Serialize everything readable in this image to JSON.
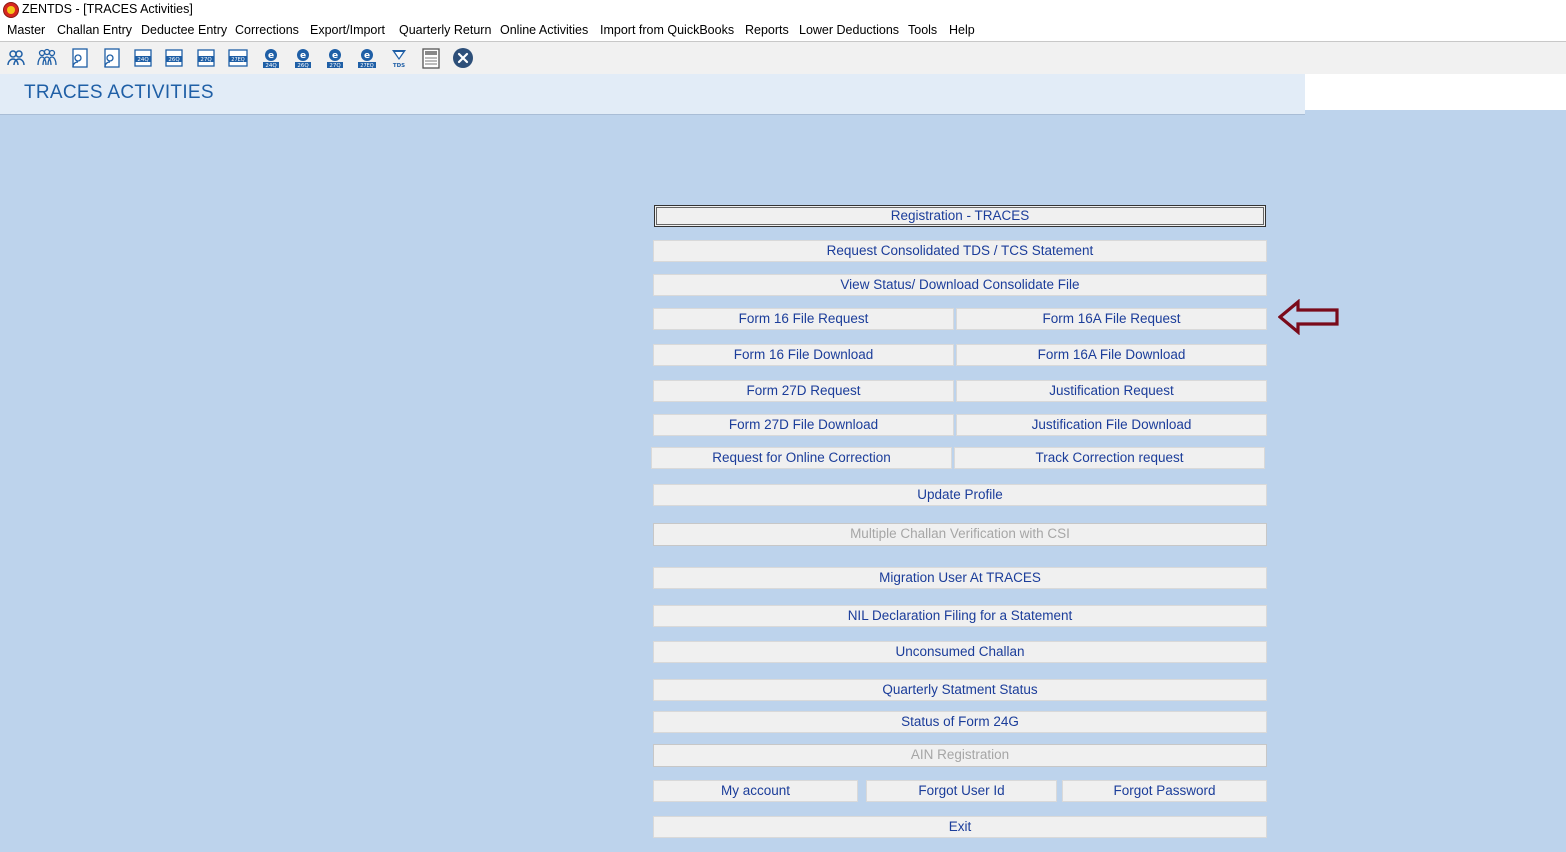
{
  "window": {
    "title": "ZENTDS - [TRACES Activities]"
  },
  "menu": [
    "Master",
    "Challan Entry",
    "Deductee Entry",
    "Corrections",
    "Export/Import",
    "Quarterly Return",
    "Online Activities",
    "Import from QuickBooks",
    "Reports",
    "Lower Deductions",
    "Tools",
    "Help"
  ],
  "toolbar": {
    "icons": [
      "deductor-icon",
      "deductee-icon",
      "form-icon",
      "form-icon",
      "form-24q-icon",
      "form-26q-icon",
      "form-27q-icon",
      "form-27eq-icon",
      "e-24q-icon",
      "e-26q-icon",
      "e-27q-icon",
      "e-27eq-icon",
      "tds-icon",
      "document-icon",
      "close-icon"
    ],
    "labels": [
      "24Q",
      "26Q",
      "27Q",
      "27EQ",
      "24Q",
      "26Q",
      "27Q",
      "27EQ",
      "TDS"
    ]
  },
  "header": {
    "title": "TRACES ACTIVITIES"
  },
  "buttons": {
    "registration": "Registration - TRACES",
    "request_consolidated": "Request Consolidated TDS / TCS Statement",
    "view_status": "View Status/ Download Consolidate File",
    "form16_request": "Form 16 File Request",
    "form16a_request": "Form 16A File Request",
    "form16_download": "Form 16 File Download",
    "form16a_download": "Form 16A File Download",
    "form27d_request": "Form 27D Request",
    "justification_request": "Justification Request",
    "form27d_download": "Form 27D File Download",
    "justification_download": "Justification File Download",
    "online_correction": "Request for Online Correction",
    "track_correction": "Track Correction request",
    "update_profile": "Update Profile",
    "multiple_challan": "Multiple Challan Verification with CSI",
    "migration_user": "Migration User At TRACES",
    "nil_declaration": "NIL Declaration Filing for a Statement",
    "unconsumed_challan": "Unconsumed Challan",
    "quarterly_status": "Quarterly Statment Status",
    "status_24g": "Status of Form 24G",
    "ain_registration": "AIN Registration",
    "my_account": "My account",
    "forgot_user": "Forgot User Id",
    "forgot_password": "Forgot Password",
    "exit": "Exit"
  },
  "colors": {
    "background": "#bdd3ec",
    "header": "#e2ecf7",
    "title": "#1f5fa6",
    "button_text": "#1b3d9a",
    "arrow": "#7a0a1a"
  }
}
